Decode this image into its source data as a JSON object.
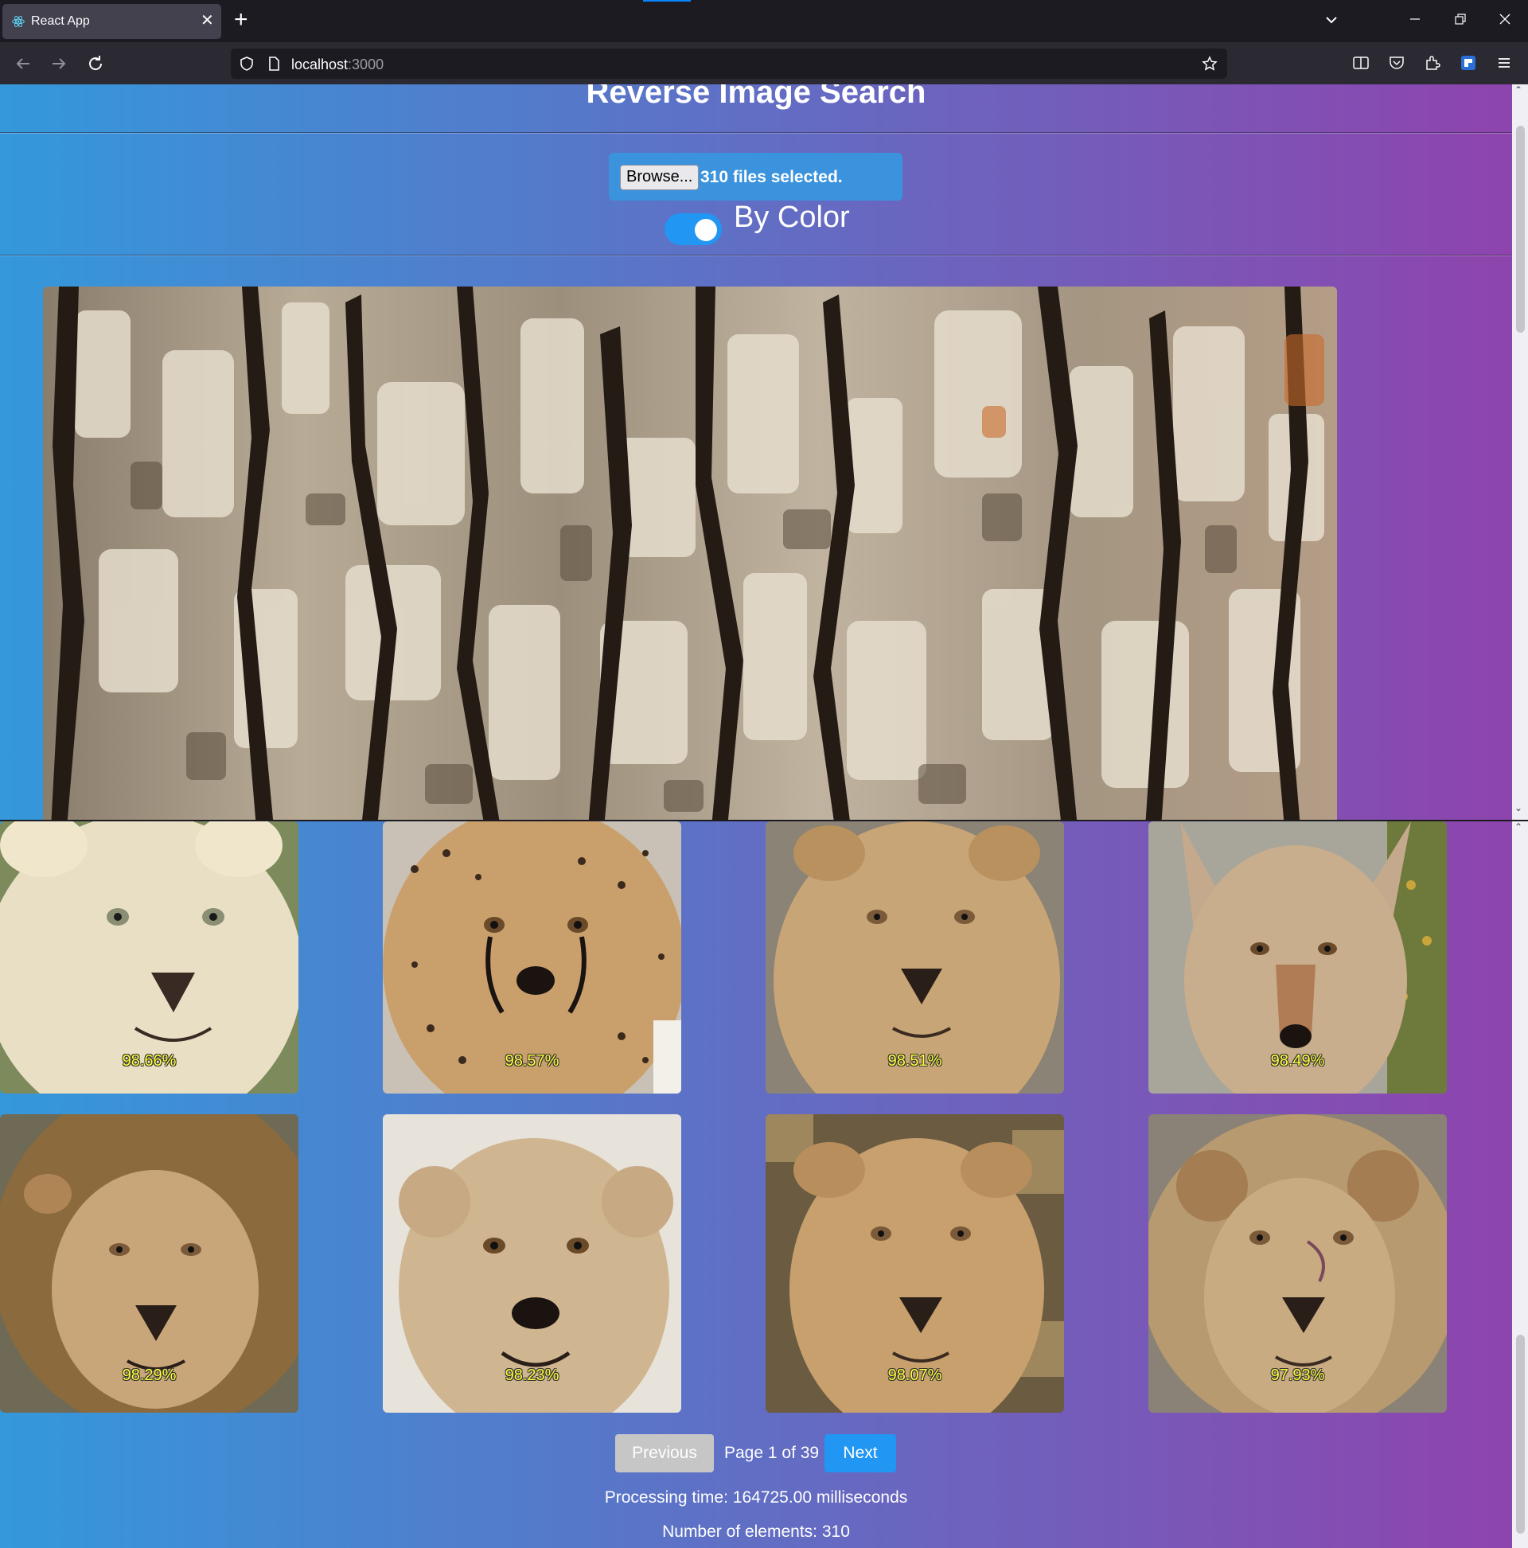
{
  "browser": {
    "tab_title": "React App",
    "url_host": "localhost",
    "url_port": ":3000"
  },
  "app": {
    "title": "Reverse Image Search",
    "browse_label": "Browse...",
    "files_selected": "310 files selected.",
    "toggle_label": "By Color",
    "toggle_on": true
  },
  "results": [
    {
      "score": "98.66%",
      "subject": "white lioness"
    },
    {
      "score": "98.57%",
      "subject": "cheetah in snow"
    },
    {
      "score": "98.51%",
      "subject": "lioness"
    },
    {
      "score": "98.49%",
      "subject": "coyote"
    },
    {
      "score": "98.29%",
      "subject": "male lion"
    },
    {
      "score": "98.23%",
      "subject": "cheetah cub"
    },
    {
      "score": "98.07%",
      "subject": "lioness"
    },
    {
      "score": "97.93%",
      "subject": "young lion"
    }
  ],
  "pagination": {
    "previous_label": "Previous",
    "page_info": "Page 1 of 39",
    "next_label": "Next"
  },
  "stats": {
    "processing_time": "Processing time: 164725.00 milliseconds",
    "element_count": "Number of elements: 310"
  },
  "colors": {
    "gradient_start": "#3498db",
    "gradient_end": "#8e44ad",
    "accent": "#2196f3",
    "score_text": "#ffff3b"
  }
}
